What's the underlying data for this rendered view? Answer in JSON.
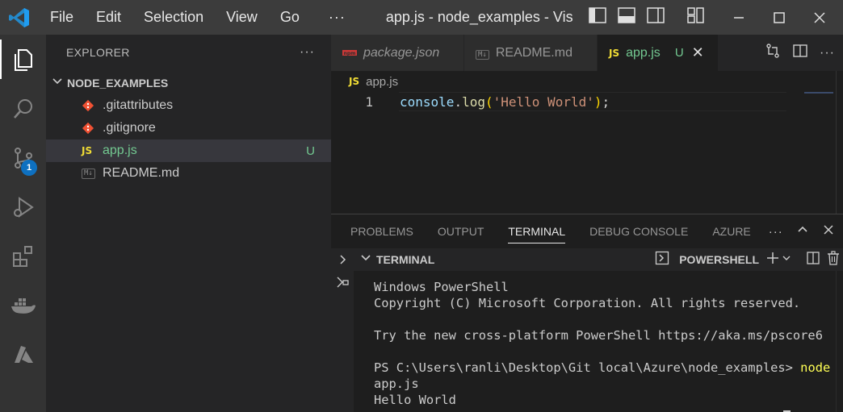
{
  "titlebar": {
    "menu": [
      "File",
      "Edit",
      "Selection",
      "View",
      "Go"
    ],
    "more": "···",
    "window_title": "app.js - node_examples - Vis"
  },
  "activity": {
    "scm_badge": "1"
  },
  "sidebar": {
    "title": "EXPLORER",
    "more": "···",
    "folder": "NODE_EXAMPLES",
    "files": [
      {
        "name": ".gitattributes",
        "icon": "git-icon",
        "status": ""
      },
      {
        "name": ".gitignore",
        "icon": "git-icon",
        "status": ""
      },
      {
        "name": "app.js",
        "icon": "js-icon",
        "status": "U",
        "icon_text": "JS"
      },
      {
        "name": "README.md",
        "icon": "markdown-icon",
        "status": "",
        "icon_text": "M↓"
      }
    ]
  },
  "editor": {
    "tabs": [
      {
        "label": "package.json",
        "icon": "npm-icon",
        "icon_text": "npm"
      },
      {
        "label": "README.md",
        "icon": "markdown-icon",
        "icon_text": "M↓"
      },
      {
        "label": "app.js",
        "icon": "js-icon",
        "icon_text": "JS",
        "status": "U",
        "close": "✕"
      }
    ],
    "breadcrumb": {
      "icon_text": "JS",
      "label": "app.js"
    },
    "lines": [
      {
        "num": "1",
        "tokens": {
          "obj": "console",
          "dot": ".",
          "fn": "log",
          "open": "(",
          "str": "'Hello World'",
          "close": ")",
          "semi": ";"
        }
      }
    ]
  },
  "panel": {
    "tabs": [
      "PROBLEMS",
      "OUTPUT",
      "TERMINAL",
      "DEBUG CONSOLE",
      "AZURE"
    ],
    "active_tab": "TERMINAL",
    "more": "···",
    "terminal": {
      "section_title": "TERMINAL",
      "shell": "POWERSHELL",
      "lines": [
        "Windows PowerShell",
        "Copyright (C) Microsoft Corporation. All rights reserved.",
        "",
        "Try the new cross-platform PowerShell https://aka.ms/pscore6",
        "",
        "PS C:\\Users\\ranli\\Desktop\\Git local\\Azure\\node_examples> ",
        "app.js",
        "Hello World"
      ],
      "prompt_command": "node"
    }
  },
  "colors": {
    "accent": "#0e70c0",
    "untracked": "#73c991",
    "js": "#f1dd35",
    "git": "#f05133"
  }
}
